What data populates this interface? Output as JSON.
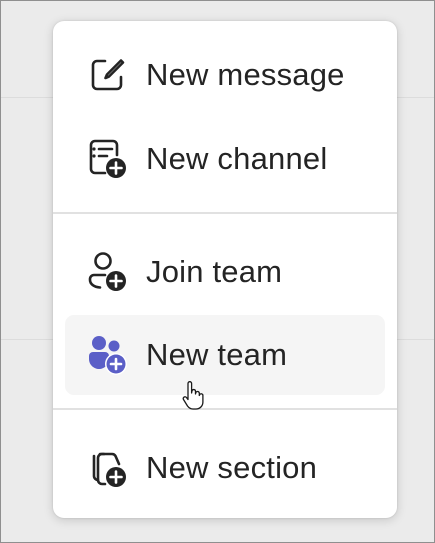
{
  "menu": {
    "items": [
      {
        "label": "New message",
        "icon": "compose-icon"
      },
      {
        "label": "New channel",
        "icon": "channel-add-icon"
      },
      {
        "label": "Join team",
        "icon": "person-add-icon"
      },
      {
        "label": "New team",
        "icon": "people-team-add-icon"
      },
      {
        "label": "New section",
        "icon": "section-add-icon"
      }
    ]
  },
  "colors": {
    "accent": "#5b5fc7",
    "text": "#242424",
    "hover_bg": "#f5f5f5"
  }
}
